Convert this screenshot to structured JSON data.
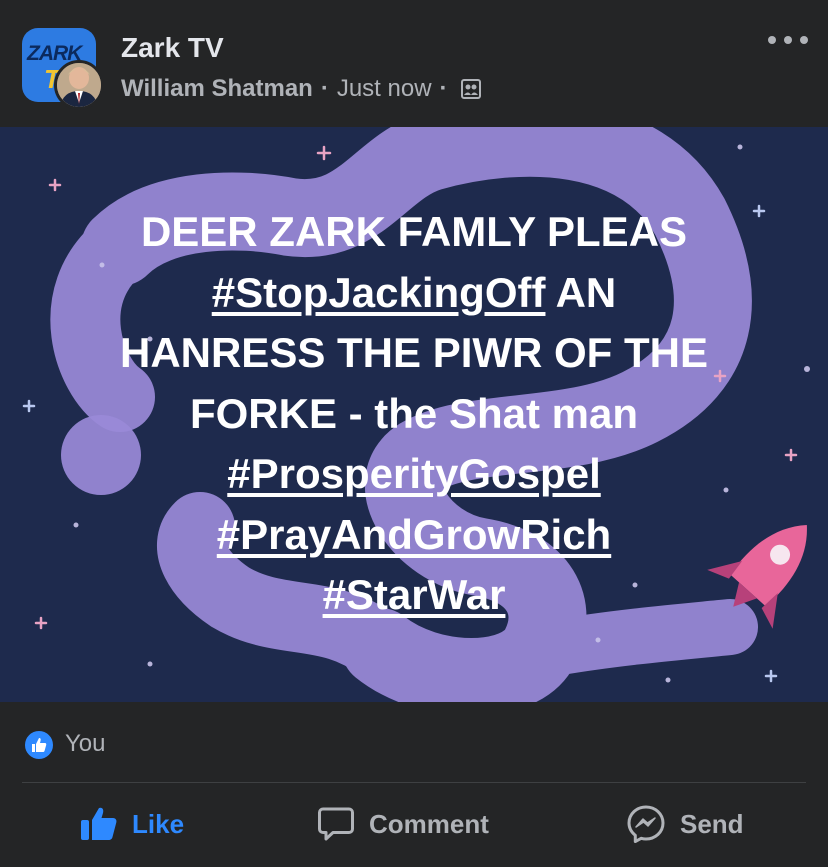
{
  "post": {
    "page_name": "Zark TV",
    "page_logo_text": "ZARK",
    "page_logo_letter": "T",
    "author": "William Shatman",
    "separator": "·",
    "time": "Just now",
    "audience_icon": "group-audience-icon",
    "more_icon": "more-options-icon"
  },
  "media": {
    "text_lines": [
      [
        {
          "text": "DEER ZARK FAMLY PLEAS",
          "link": false
        }
      ],
      [
        {
          "text": "#StopJackingOff",
          "link": true
        },
        {
          "text": " AN",
          "link": false
        }
      ],
      [
        {
          "text": "HANRESS THE PIWR OF THE",
          "link": false
        }
      ],
      [
        {
          "text": "FORKE - the Shat man",
          "link": false
        }
      ],
      [
        {
          "text": "#ProsperityGospel",
          "link": true
        }
      ],
      [
        {
          "text": "#PrayAndGrowRich",
          "link": true
        }
      ],
      [
        {
          "text": "#StarWar",
          "link": true
        }
      ]
    ],
    "colors": {
      "background": "#1e2a4d",
      "blob": "#9a8ad8",
      "rocket": "#e8669a"
    }
  },
  "reactions": {
    "icon": "like-reaction-icon",
    "names": "You"
  },
  "actions": {
    "like_label": "Like",
    "comment_label": "Comment",
    "send_label": "Send"
  },
  "colors": {
    "accent": "#2e89ff",
    "surface": "#242526",
    "secondary_text": "#b0b3b8"
  }
}
